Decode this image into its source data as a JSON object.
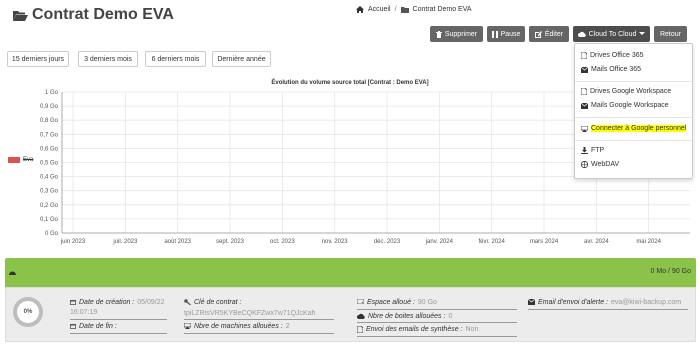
{
  "header": {
    "title": "Contrat Demo EVA",
    "breadcrumb": {
      "home": "Accueil",
      "current": "Contrat Demo EVA"
    }
  },
  "toolbar": {
    "delete_label": "Supprimer",
    "pause_label": "Pause",
    "edit_label": "Éditer",
    "cloud_label": "Cloud To Cloud",
    "back_label": "Retour"
  },
  "ranges": [
    "15 derniers jours",
    "3 derniers mois",
    "6 derniers mois",
    "Dernière année"
  ],
  "dropdown": {
    "group1": [
      "Drives Office 365",
      "Mails Office 365"
    ],
    "group2": [
      "Drives Google Workspace",
      "Mails Google Workspace"
    ],
    "group3": [
      "Connecter à Google personnel"
    ],
    "group4": [
      "FTP",
      "WebDAV"
    ],
    "highlight_color": "#ffff00"
  },
  "chart_data": {
    "type": "line",
    "title": "Évolution du volume source total [Contrat : Demo EVA]",
    "x": [
      "juin 2023",
      "juil. 2023",
      "août 2023",
      "sept. 2023",
      "oct. 2023",
      "nov. 2023",
      "déc. 2023",
      "janv. 2024",
      "févr. 2024",
      "mars 2024",
      "avr. 2024",
      "mai 2024"
    ],
    "y_ticks": [
      "0 Go",
      "0,1 Go",
      "0,2 Go",
      "0,3 Go",
      "0,4 Go",
      "0,5 Go",
      "0,6 Go",
      "0,7 Go",
      "0,8 Go",
      "0,9 Go",
      "1 Go"
    ],
    "ylim": [
      0,
      1
    ],
    "series": [
      {
        "name": "Eva",
        "values": [],
        "color": "#d9534f"
      }
    ],
    "grid": true,
    "legend": "left"
  },
  "status": {
    "usage": "0 Mo / 90 Go",
    "percent": "0%",
    "accent": "#8bc34a"
  },
  "info": {
    "created_label": "Date de création :",
    "created_date": "05/09/22",
    "created_time": "16:07:19",
    "end_label": "Date de fin :",
    "key_label": "Clé de contrat :",
    "key_value": "tpiLZRtsVR5KYBeCQKFZwx7w71QJcKah",
    "machines_label": "Nbre de machines allouées :",
    "machines_value": "2",
    "space_label": "Espace alloué :",
    "space_value": "90 Go",
    "boxes_label": "Nbre de boites allouées :",
    "boxes_value": "0",
    "emails_label": "Envoi des emails de synthèse :",
    "emails_value": "Non",
    "alert_label": "Email d'envoi d'alerte :",
    "alert_value": "eva@kiwi-backup.com"
  }
}
